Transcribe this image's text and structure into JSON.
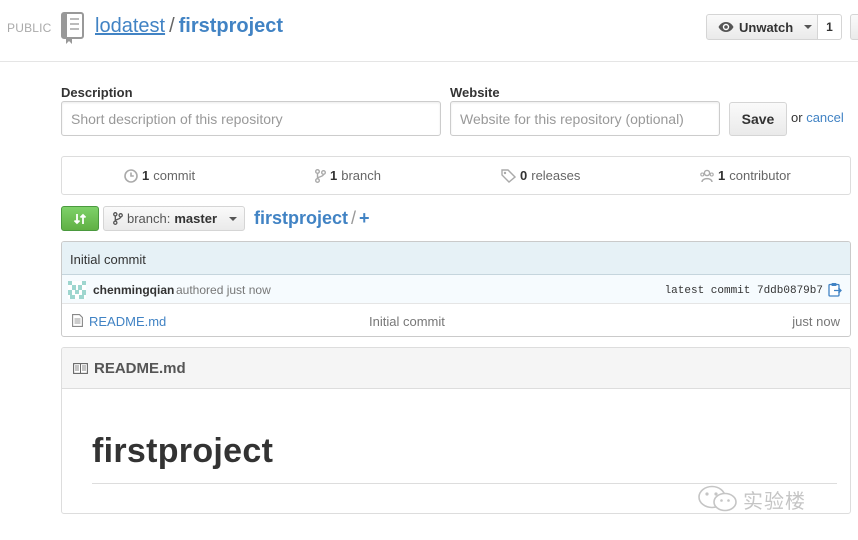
{
  "header": {
    "visibility": "PUBLIC",
    "owner": "lodatest",
    "separator": "/",
    "repo": "firstproject",
    "watch_label": "Unwatch",
    "watch_count": "1",
    "repo_icon": "repo-book-icon"
  },
  "edit_form": {
    "description_label": "Description",
    "description_placeholder": "Short description of this repository",
    "website_label": "Website",
    "website_placeholder": "Website for this repository (optional)",
    "save_label": "Save",
    "or_text": "or",
    "cancel_label": "cancel"
  },
  "summary": {
    "commits_count": "1",
    "commits_label": "commit",
    "branches_count": "1",
    "branches_label": "branch",
    "releases_count": "0",
    "releases_label": "releases",
    "contributors_count": "1",
    "contributors_label": "contributor"
  },
  "branch_bar": {
    "branch_prefix": "branch:",
    "branch_name": "master",
    "path_repo": "firstproject",
    "path_sep": "/",
    "add_label": "+"
  },
  "file_table": {
    "commit_message": "Initial commit",
    "author": "chenmingqian",
    "authored_text": "authored just now",
    "latest_commit_text": "latest commit 7ddb0879b7",
    "files": [
      {
        "name": "README.md",
        "message": "Initial commit",
        "age": "just now"
      }
    ]
  },
  "readme": {
    "filename": "README.md",
    "heading": "firstproject"
  },
  "watermark": {
    "text": "实验楼"
  },
  "colors": {
    "link": "#4183c4",
    "green": "#60b044",
    "commit_bg": "#e6f1f6"
  }
}
